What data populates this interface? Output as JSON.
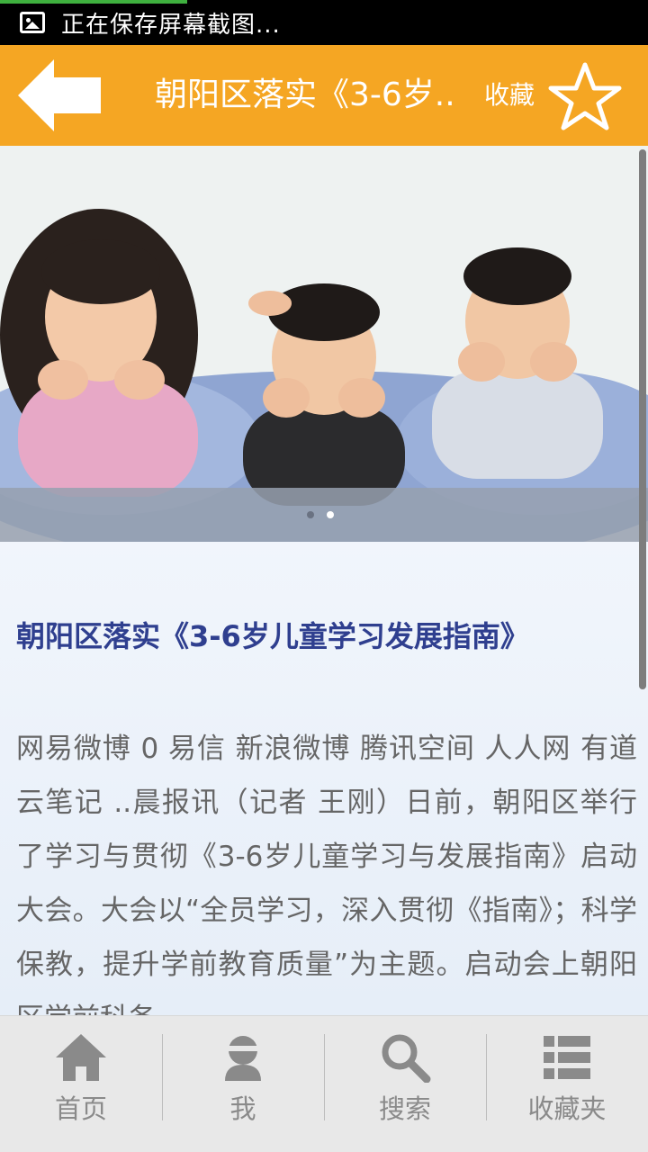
{
  "status_bar": {
    "text": "正在保存屏幕截图..."
  },
  "header": {
    "title": "朝阳区落实《3-6岁..",
    "favorite_label": "收藏",
    "icons": {
      "back": "back-arrow-icon",
      "favorite": "star-outline-icon"
    },
    "color": "#f5a623"
  },
  "banner": {
    "slide_count": 2,
    "active_slide": 2
  },
  "article": {
    "title": "朝阳区落实《3-6岁儿童学习发展指南》",
    "body": "网易微博 0 易信 新浪微博 腾讯空间 人人网 有道云笔记 ..晨报讯（记者 王刚）日前，朝阳区举行了学习与贯彻《3-6岁儿童学习与发展指南》启动大会。大会以“全员学习，深入贯彻《指南》；科学保教，提升学前教育质量”为主题。启动会上朝阳区学前科务"
  },
  "bottom_nav": {
    "items": [
      {
        "label": "首页",
        "icon": "home-icon"
      },
      {
        "label": "我",
        "icon": "user-icon"
      },
      {
        "label": "搜索",
        "icon": "search-icon"
      },
      {
        "label": "收藏夹",
        "icon": "list-icon"
      }
    ]
  }
}
